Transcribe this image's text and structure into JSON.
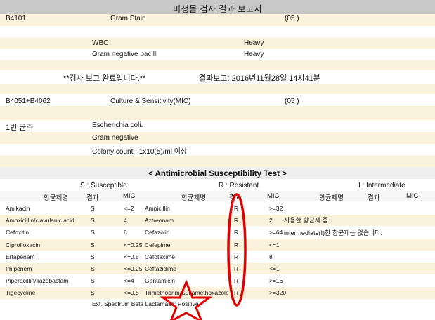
{
  "title": "미생물 검사 결과 보고서",
  "stain": {
    "code": "B4101",
    "name": "Gram Stain",
    "num": "(05 )",
    "results": [
      {
        "label": "WBC",
        "value": "Heavy"
      },
      {
        "label": "Gram negative bacilli",
        "value": "Heavy"
      }
    ]
  },
  "completion": {
    "message": "**검사  보고  완료입니다.**",
    "report_label": "결과보고: 2016년11월28일 14시41분"
  },
  "culture": {
    "code": "B4051+B4062",
    "name": "Culture & Sensitivity(MIC)",
    "num": "(05 )"
  },
  "isolate": {
    "label": "1번 균주",
    "lines": [
      "Escherichia coli.",
      "Gram negative",
      "Colony count ; 1x10(5)/ml 이상"
    ]
  },
  "ast": {
    "title": "< Antimicrobial Susceptibility Test >",
    "legend": [
      "S : Susceptible",
      "R : Resistant",
      "I : Intermediate"
    ],
    "headers": [
      "항균제명",
      "결과",
      "MIC"
    ],
    "col1": [
      {
        "drug": "Amikacin",
        "result": "S",
        "mic": "<=2"
      },
      {
        "drug": "Amoxicillin/clavulanic acid",
        "result": "S",
        "mic": "4"
      },
      {
        "drug": "Cefoxitin",
        "result": "S",
        "mic": "8"
      },
      {
        "drug": "Ciprofloxacin",
        "result": "S",
        "mic": "<=0.25"
      },
      {
        "drug": "Ertapenem",
        "result": "S",
        "mic": "<=0.5"
      },
      {
        "drug": "Imipenem",
        "result": "S",
        "mic": "<=0.25"
      },
      {
        "drug": "Piperacillin/Tazobactam",
        "result": "S",
        "mic": "<=4"
      },
      {
        "drug": "Tigecycline",
        "result": "S",
        "mic": "<=0.5"
      }
    ],
    "col2": [
      {
        "drug": "Ampicillin",
        "result": "R",
        "mic": ">=32"
      },
      {
        "drug": "Aztreonam",
        "result": "R",
        "mic": "2"
      },
      {
        "drug": "Cefazolin",
        "result": "R",
        "mic": ">=64"
      },
      {
        "drug": "Cefepime",
        "result": "R",
        "mic": "<=1"
      },
      {
        "drug": "Cefotaxime",
        "result": "R",
        "mic": "8"
      },
      {
        "drug": "Ceftazidime",
        "result": "R",
        "mic": "<=1"
      },
      {
        "drug": "Gentamicin",
        "result": "R",
        "mic": ">=16"
      },
      {
        "drug": "Trimethoprim/Sulfamethoxazole",
        "result": "R",
        "mic": ">=320"
      }
    ],
    "notes": [
      "사용한 항균제 중",
      "intermediate(I)한 항균제는 없습니다."
    ],
    "esbl": "Ext. Spectrum Beta Lactamase: Positive"
  },
  "colors": {
    "title_bar": "#c8c8c8",
    "row_tan": "#fbf2dc",
    "annotation_red": "#e00000"
  }
}
